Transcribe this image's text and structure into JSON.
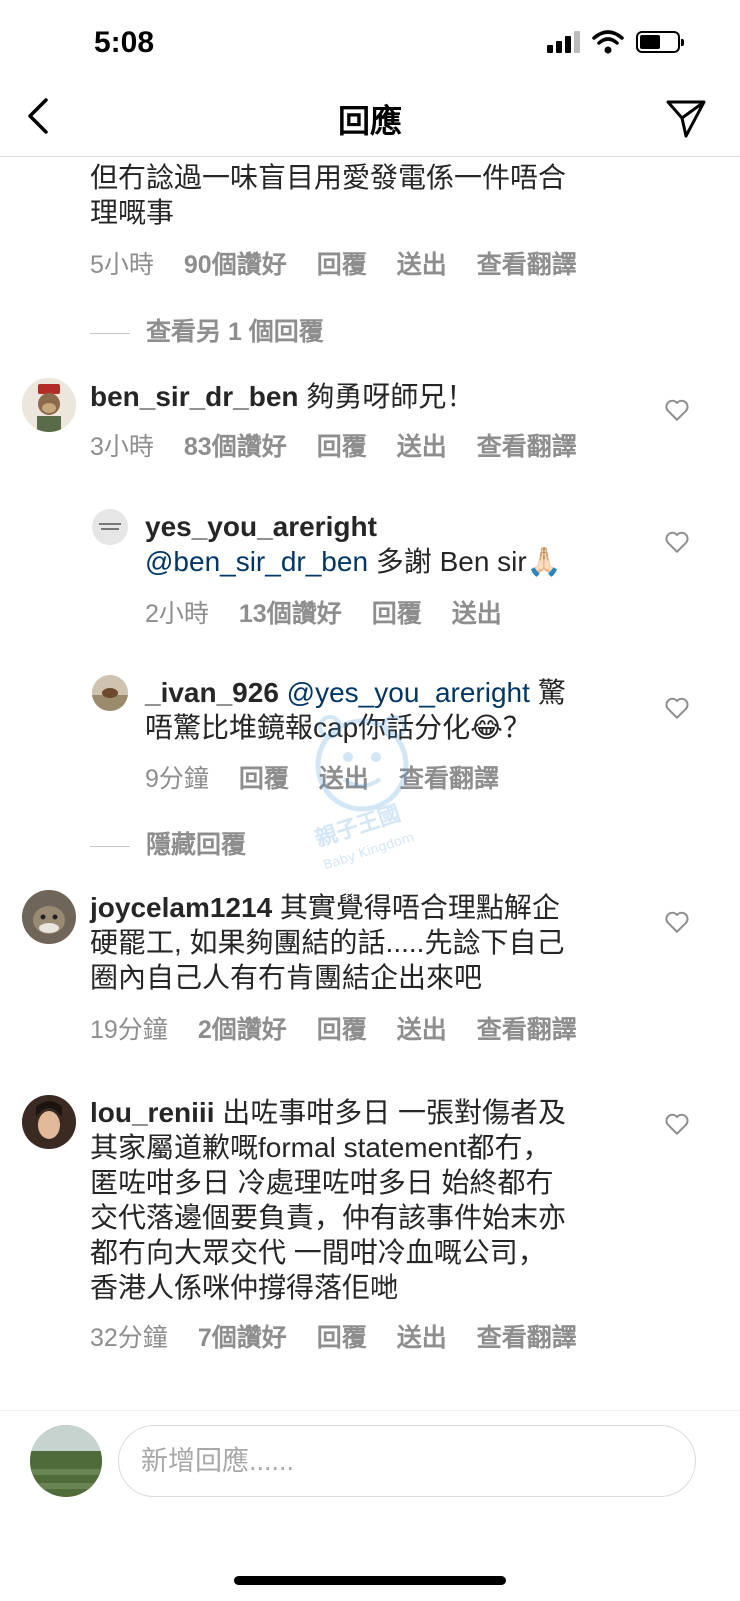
{
  "status_bar": {
    "time": "5:08",
    "battery_level": 0.55
  },
  "header": {
    "title": "回應"
  },
  "comments": [
    {
      "continued_text_1": "但冇諗過一味盲目用愛發電係一件唔合",
      "continued_text_2": "理嘅事",
      "time": "5小時",
      "likes": "90個讚好",
      "reply": "回覆",
      "send": "送出",
      "translate": "查看翻譯",
      "view_more": "查看另 1 個回覆"
    },
    {
      "username": "ben_sir_dr_ben",
      "text": "夠勇呀師兄！",
      "time": "3小時",
      "likes": "83個讚好",
      "reply": "回覆",
      "send": "送出",
      "translate": "查看翻譯",
      "replies": [
        {
          "username": "yes_you_areright",
          "mention": "@ben_sir_dr_ben",
          "text": "多謝 Ben sir🙏🏻",
          "time": "2小時",
          "likes": "13個讚好",
          "reply": "回覆",
          "send": "送出"
        },
        {
          "username": "_ivan_926",
          "mention": "@yes_you_areright",
          "text_1": "驚",
          "text_2": "唔驚比堆鏡報cap你話分化😂？",
          "time": "9分鐘",
          "reply": "回覆",
          "send": "送出",
          "translate": "查看翻譯"
        }
      ],
      "hide_replies": "隱藏回覆"
    },
    {
      "username": "joycelam1214",
      "line_1": "其實覺得唔合理點解企",
      "line_2": "硬罷工, 如果夠團結的話.....先諗下自己",
      "line_3": "圈內自己人有冇肯團結企出來吧",
      "time": "19分鐘",
      "likes": "2個讚好",
      "reply": "回覆",
      "send": "送出",
      "translate": "查看翻譯"
    },
    {
      "username": "lou_reniii",
      "line_1": "出咗事咁多日  一張對傷者及",
      "line_2": "其家屬道歉嘅formal statement都冇，",
      "line_3": "匿咗咁多日 冷處理咗咁多日  始終都冇",
      "line_4": "交代落邊個要負責，仲有該事件始末亦",
      "line_5": "都冇向大眾交代  一間咁冷血嘅公司，",
      "line_6": "香港人係咪仲撐得落佢哋",
      "time": "32分鐘",
      "likes": "7個讚好",
      "reply": "回覆",
      "send": "送出",
      "translate": "查看翻譯"
    }
  ],
  "watermark": {
    "line_1": "親子王國",
    "line_2": "Baby Kingdom"
  },
  "input": {
    "placeholder": "新增回應......"
  }
}
